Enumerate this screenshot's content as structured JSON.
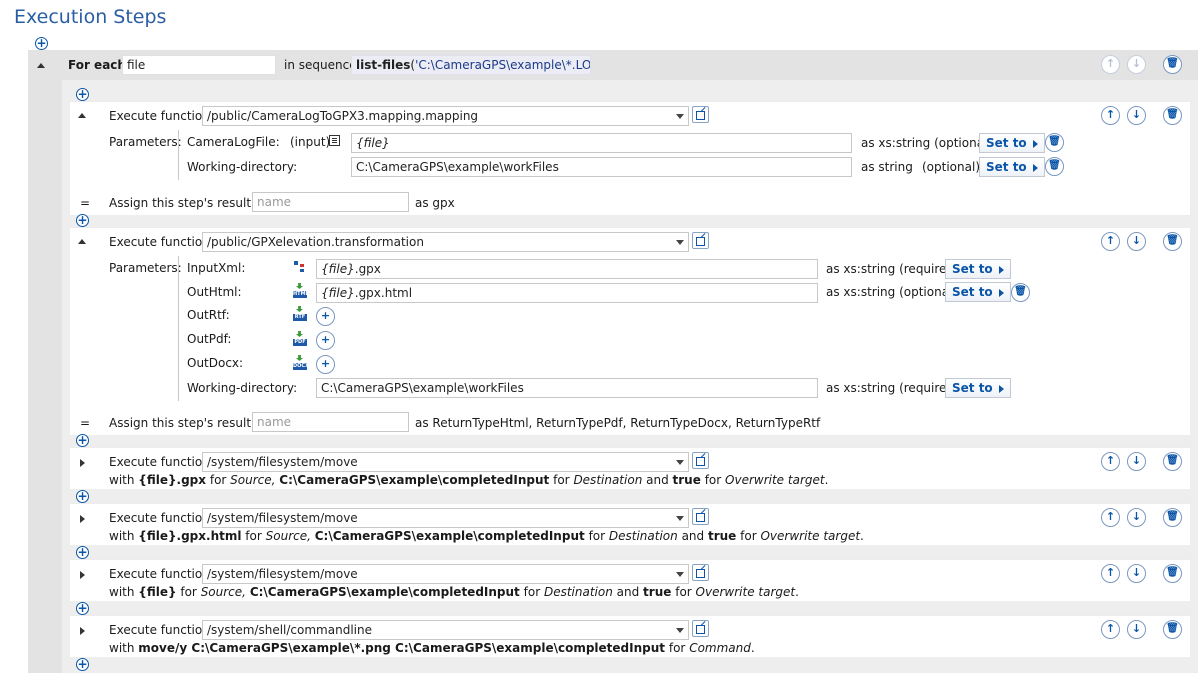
{
  "page": {
    "title": "Execution Steps"
  },
  "icons": {
    "add": "+",
    "up": "↑",
    "down": "↓",
    "delete": "🗑",
    "external": "open-external",
    "list": "list"
  },
  "foreach": {
    "for_each_label": "For each",
    "variable": "file",
    "in_sequence_label": "in sequence",
    "func_name": "list-files",
    "func_open": "(",
    "func_arg": "'C:\\CameraGPS\\example\\*.LOG'",
    "func_close": ")"
  },
  "step1": {
    "execute_label": "Execute function",
    "function": "/public/CameraLogToGPX3.mapping.mapping",
    "params_label": "Parameters:",
    "params": [
      {
        "name": "CameraLogFile:",
        "mode": "(input)",
        "value_var": "{file}",
        "type": "as xs:string (optional)",
        "set_to": "Set to"
      },
      {
        "name": "Working-directory:",
        "value": "C:\\CameraGPS\\example\\workFiles",
        "type": "as string",
        "optional": "(optional)",
        "set_to": "Set to"
      }
    ],
    "assign_prefix": "=",
    "assign_label": "Assign this step's result to",
    "assign_placeholder": "name",
    "assign_as": "as gpx"
  },
  "step2": {
    "execute_label": "Execute function",
    "function": "/public/GPXelevation.transformation",
    "params_label": "Parameters:",
    "params": [
      {
        "name": "InputXml:",
        "value_var": "{file}",
        "value_rest": ".gpx",
        "type": "as xs:string (required)",
        "set_to": "Set to"
      },
      {
        "name": "OutHtml:",
        "icon_tag": "HTML",
        "value_var": "{file}",
        "value_rest": ".gpx.html",
        "type": "as xs:string (optional)",
        "set_to": "Set to"
      },
      {
        "name": "OutRtf:",
        "icon_tag": "RTF"
      },
      {
        "name": "OutPdf:",
        "icon_tag": "PDF"
      },
      {
        "name": "OutDocx:",
        "icon_tag": "DOCX"
      },
      {
        "name": "Working-directory:",
        "value": "C:\\CameraGPS\\example\\workFiles",
        "type": "as xs:string (required)",
        "set_to": "Set to"
      }
    ],
    "assign_prefix": "=",
    "assign_label": "Assign this step's result to",
    "assign_placeholder": "name",
    "assign_as": "as ReturnTypeHtml, ReturnTypePdf, ReturnTypeDocx, ReturnTypeRtf"
  },
  "step3": {
    "execute_label": "Execute function",
    "function": "/system/filesystem/move",
    "with": "with",
    "src": "{file}.gpx",
    "for1": "for",
    "src_name": "Source,",
    "dest": "C:\\CameraGPS\\example\\completedInput",
    "for2": "for",
    "dest_name": "Destination",
    "and": "and",
    "flag": "true",
    "for3": "for",
    "flag_name": "Overwrite target",
    "end": "."
  },
  "step4": {
    "execute_label": "Execute function",
    "function": "/system/filesystem/move",
    "with": "with",
    "src": "{file}.gpx.html",
    "for1": "for",
    "src_name": "Source,",
    "dest": "C:\\CameraGPS\\example\\completedInput",
    "for2": "for",
    "dest_name": "Destination",
    "and": "and",
    "flag": "true",
    "for3": "for",
    "flag_name": "Overwrite target",
    "end": "."
  },
  "step5": {
    "execute_label": "Execute function",
    "function": "/system/filesystem/move",
    "with": "with",
    "src": "{file}",
    "for1": "for",
    "src_name": "Source,",
    "dest": "C:\\CameraGPS\\example\\completedInput",
    "for2": "for",
    "dest_name": "Destination",
    "and": "and",
    "flag": "true",
    "for3": "for",
    "flag_name": "Overwrite target",
    "end": "."
  },
  "step6": {
    "execute_label": "Execute function",
    "function": "/system/shell/commandline",
    "with": "with",
    "cmd": "move/y C:\\CameraGPS\\example\\*.png C:\\CameraGPS\\example\\completedInput",
    "for1": "for",
    "cmd_name": "Command",
    "end": "."
  }
}
